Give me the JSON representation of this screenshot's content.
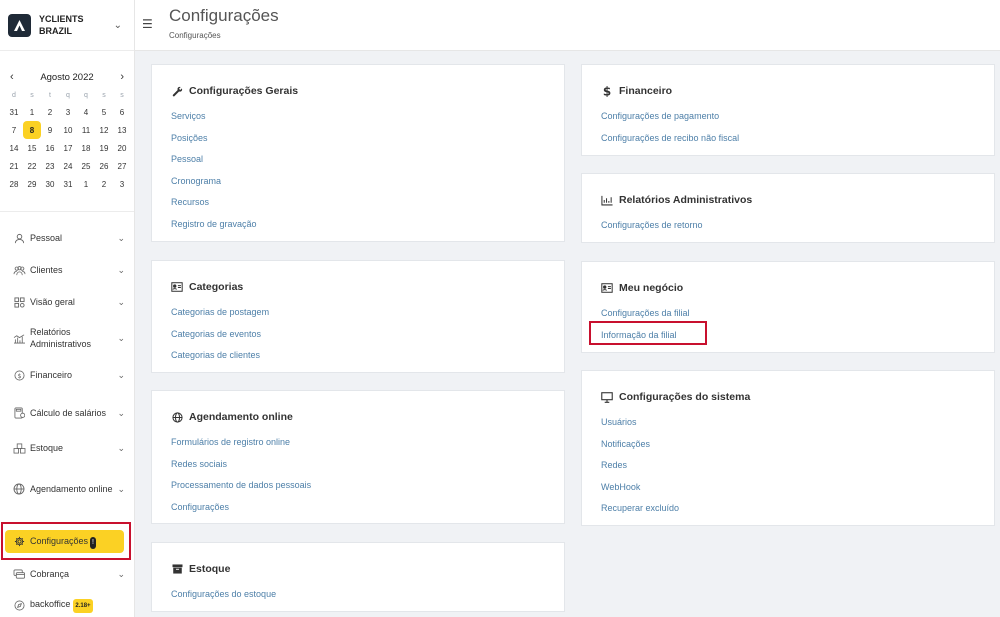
{
  "brand": {
    "name": "YCLIENTS BRAZIL"
  },
  "calendar": {
    "month_label": "Agosto 2022",
    "weekdays": [
      "d",
      "s",
      "t",
      "q",
      "q",
      "s",
      "s"
    ],
    "weeks": [
      [
        "31",
        "1",
        "2",
        "3",
        "4",
        "5",
        "6"
      ],
      [
        "7",
        "8",
        "9",
        "10",
        "11",
        "12",
        "13"
      ],
      [
        "14",
        "15",
        "16",
        "17",
        "18",
        "19",
        "20"
      ],
      [
        "21",
        "22",
        "23",
        "24",
        "25",
        "26",
        "27"
      ],
      [
        "28",
        "29",
        "30",
        "31",
        "1",
        "2",
        "3"
      ]
    ],
    "today": "8"
  },
  "sidebar": {
    "items": [
      {
        "label": "Pessoal",
        "icon": "user-icon"
      },
      {
        "label": "Clientes",
        "icon": "users-icon"
      },
      {
        "label": "Visão geral",
        "icon": "grid-icon"
      },
      {
        "label": "Relatórios Administrativos",
        "icon": "chart-icon"
      },
      {
        "label": "Financeiro",
        "icon": "dollar-icon"
      },
      {
        "label": "Cálculo de salários",
        "icon": "calculator-icon"
      },
      {
        "label": "Estoque",
        "icon": "boxes-icon"
      },
      {
        "label": "Agendamento online",
        "icon": "globe-icon"
      },
      {
        "label": "Configurações",
        "icon": "gear-icon",
        "badge": "!"
      },
      {
        "label": "Cobrança",
        "icon": "cards-icon"
      },
      {
        "label": "backoffice",
        "icon": "compass-icon",
        "badge": "2.18+"
      }
    ]
  },
  "header": {
    "title": "Configurações",
    "breadcrumb": "Configurações"
  },
  "cards": {
    "gerais": {
      "title": "Configurações Gerais",
      "links": [
        "Serviços",
        "Posições",
        "Pessoal",
        "Cronograma",
        "Recursos",
        "Registro de gravação"
      ]
    },
    "categorias": {
      "title": "Categorias",
      "links": [
        "Categorias de postagem",
        "Categorias de eventos",
        "Categorias de clientes"
      ]
    },
    "agendamento": {
      "title": "Agendamento online",
      "links": [
        "Formulários de registro online",
        "Redes sociais",
        "Processamento de dados pessoais",
        "Configurações"
      ]
    },
    "estoque": {
      "title": "Estoque",
      "links": [
        "Configurações do estoque"
      ]
    },
    "financeiro": {
      "title": "Financeiro",
      "links": [
        "Configurações de pagamento",
        "Configurações de recibo não fiscal"
      ]
    },
    "relatorios": {
      "title": "Relatórios Administrativos",
      "links": [
        "Configurações de retorno"
      ]
    },
    "negocio": {
      "title": "Meu negócio",
      "links": [
        "Configurações da filial",
        "Informação da filial"
      ]
    },
    "sistema": {
      "title": "Configurações do sistema",
      "links": [
        "Usuários",
        "Notificações",
        "Redes",
        "WebHook",
        "Recuperar excluído"
      ]
    }
  },
  "colors": {
    "accent": "#fbd124",
    "link": "#4d7fa8",
    "highlight": "#c8102e"
  }
}
